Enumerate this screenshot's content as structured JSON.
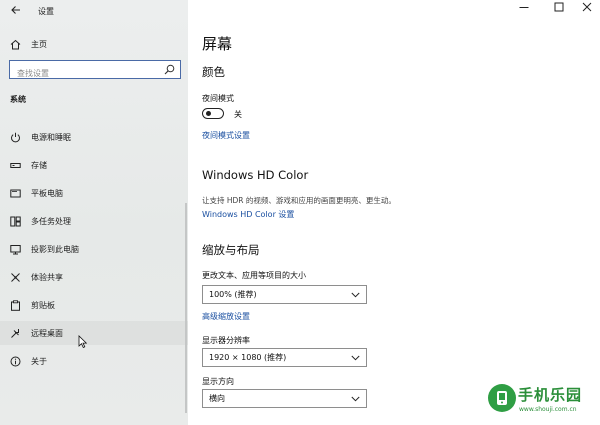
{
  "window": {
    "app_title": "设置",
    "back_icon": "back-arrow-icon",
    "minimize_icon": "minimize-icon",
    "maximize_icon": "maximize-icon",
    "close_icon": "close-icon"
  },
  "sidebar": {
    "home_label": "主页",
    "search_placeholder": "查找设置",
    "section_label": "系统",
    "items": [
      {
        "label": "电源和睡眠",
        "icon": "power-icon"
      },
      {
        "label": "存储",
        "icon": "storage-icon"
      },
      {
        "label": "平板电脑",
        "icon": "tablet-icon"
      },
      {
        "label": "多任务处理",
        "icon": "multitasking-icon"
      },
      {
        "label": "投影到此电脑",
        "icon": "project-icon"
      },
      {
        "label": "体验共享",
        "icon": "shared-experiences-icon"
      },
      {
        "label": "剪贴板",
        "icon": "clipboard-icon"
      },
      {
        "label": "远程桌面",
        "icon": "remote-desktop-icon"
      },
      {
        "label": "关于",
        "icon": "info-icon"
      }
    ]
  },
  "main": {
    "page_title": "屏幕",
    "color_heading": "颜色",
    "night_mode_label": "夜间模式",
    "night_mode_state": "关",
    "night_mode_link": "夜间模式设置",
    "hd_heading": "Windows HD Color",
    "hd_description": "让支持 HDR 的视频、游戏和应用的画面更明亮、更生动。",
    "hd_link": "Windows HD Color 设置",
    "scale_heading": "缩放与布局",
    "scale_label": "更改文本、应用等项目的大小",
    "scale_value": "100% (推荐)",
    "advanced_scale_link": "高级缩放设置",
    "resolution_label": "显示器分辨率",
    "resolution_value": "1920 × 1080 (推荐)",
    "orientation_label": "显示方向",
    "orientation_value": "横向"
  },
  "watermark": {
    "text": "手机乐园",
    "sub": "www.shouji.com.cn"
  },
  "colors": {
    "accent_link": "#1a4fa0",
    "search_border": "#4a6aa6",
    "logo_green": "#2f9e44"
  }
}
